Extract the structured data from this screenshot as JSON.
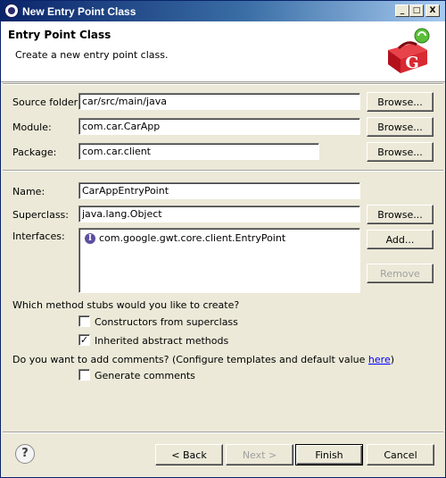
{
  "window": {
    "title": "New Entry Point Class",
    "minimize": "_",
    "maximize": "□",
    "close": "X"
  },
  "header": {
    "title": "Entry Point Class",
    "description": "Create a new entry point class.",
    "logo_letter": "G",
    "logo_icon": "gwt-toolbox-icon"
  },
  "form": {
    "source_folder": {
      "label": "Source folder:",
      "value": "car/src/main/java",
      "button": "Browse..."
    },
    "module": {
      "label": "Module:",
      "value": "com.car.CarApp",
      "button": "Browse..."
    },
    "package": {
      "label": "Package:",
      "value": "com.car.client",
      "button": "Browse..."
    },
    "name": {
      "label": "Name:",
      "value": "CarAppEntryPoint"
    },
    "superclass": {
      "label": "Superclass:",
      "value": "java.lang.Object",
      "button": "Browse..."
    },
    "interfaces": {
      "label": "Interfaces:",
      "items": [
        {
          "icon": "I",
          "name": "com.google.gwt.core.client.EntryPoint"
        }
      ],
      "add_button": "Add...",
      "remove_button": "Remove"
    }
  },
  "stubs": {
    "question": "Which method stubs would you like to create?",
    "constructors": {
      "label": "Constructors from superclass",
      "checked": false
    },
    "inherited": {
      "label": "Inherited abstract methods",
      "checked": true
    }
  },
  "comments": {
    "question_prefix": "Do you want to add comments? (Configure templates and default value ",
    "link": "here",
    "question_suffix": ")",
    "generate": {
      "label": "Generate comments",
      "checked": false
    }
  },
  "footer": {
    "help": "?",
    "back": "< Back",
    "next": "Next >",
    "finish": "Finish",
    "cancel": "Cancel"
  },
  "check_mark": "✓"
}
